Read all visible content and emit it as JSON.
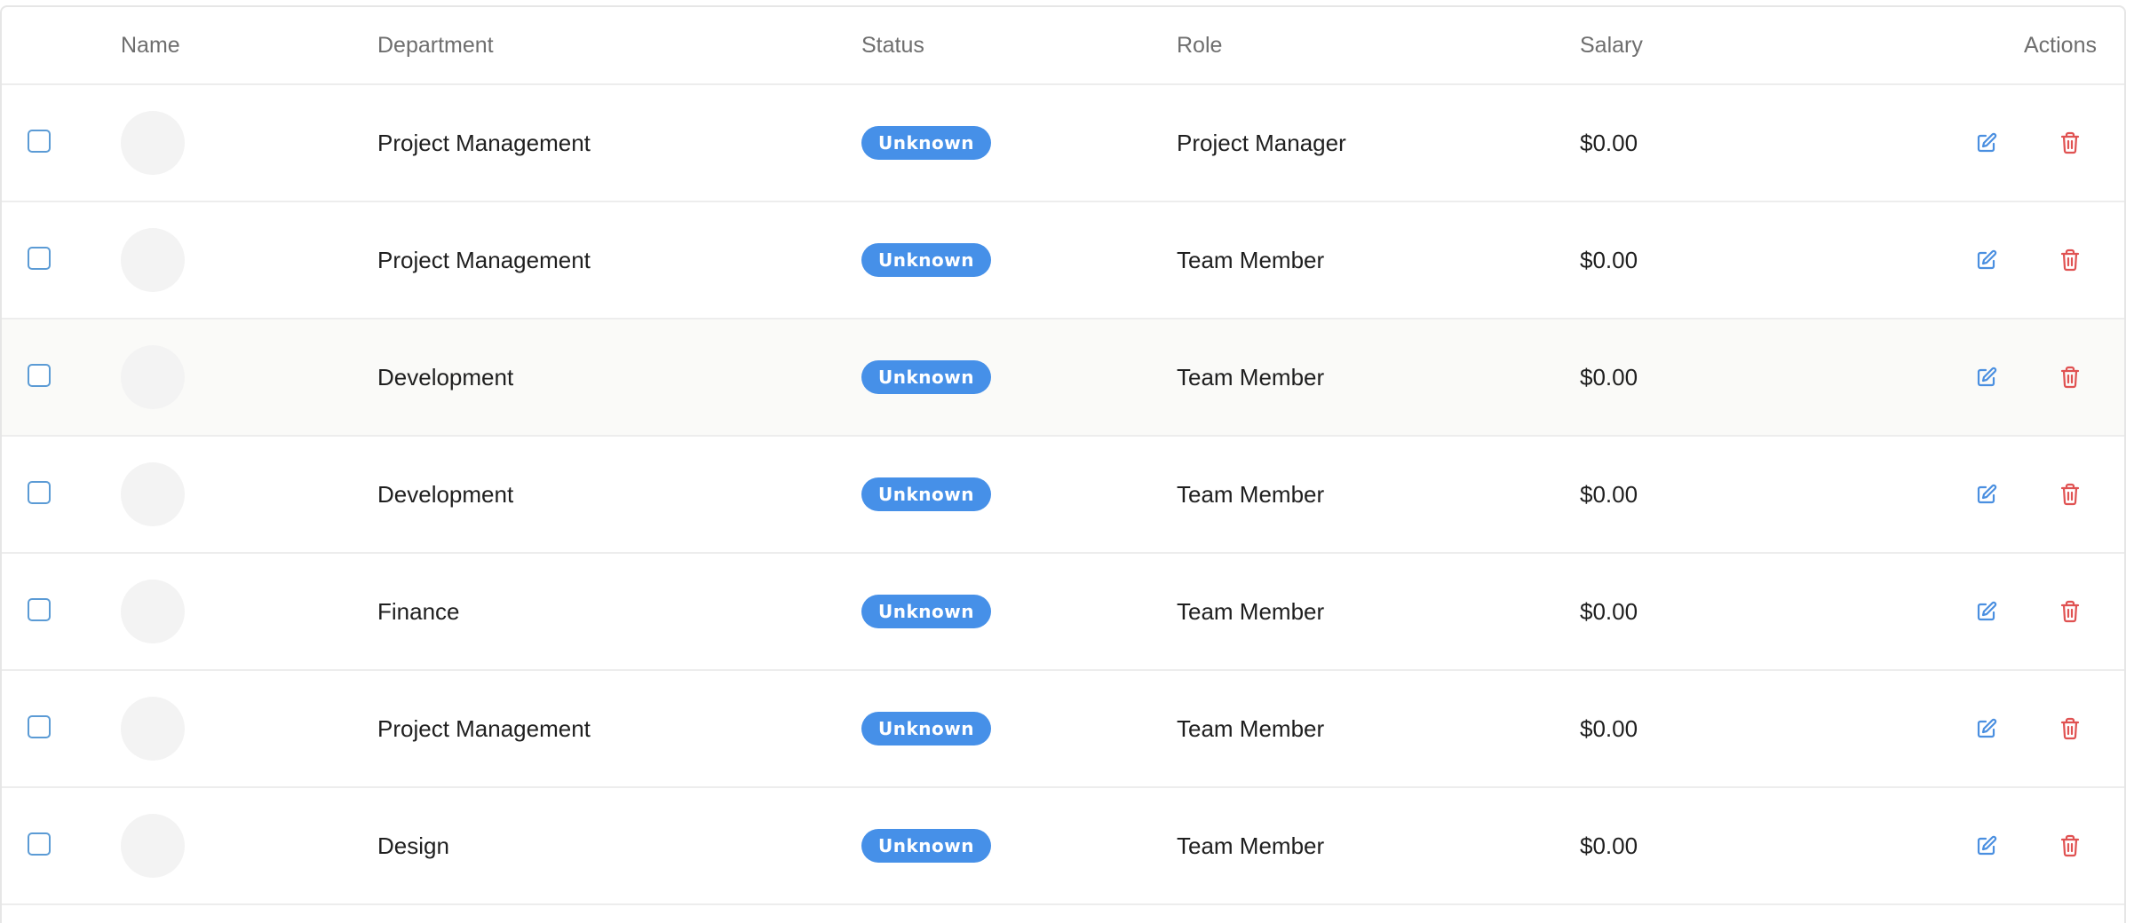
{
  "table": {
    "columns": {
      "name": "Name",
      "department": "Department",
      "status": "Status",
      "role": "Role",
      "salary": "Salary",
      "actions": "Actions"
    },
    "rows": [
      {
        "department": "Project Management",
        "status": "Unknown",
        "role": "Project Manager",
        "salary": "$0.00"
      },
      {
        "department": "Project Management",
        "status": "Unknown",
        "role": "Team Member",
        "salary": "$0.00"
      },
      {
        "department": "Development",
        "status": "Unknown",
        "role": "Team Member",
        "salary": "$0.00"
      },
      {
        "department": "Development",
        "status": "Unknown",
        "role": "Team Member",
        "salary": "$0.00"
      },
      {
        "department": "Finance",
        "status": "Unknown",
        "role": "Team Member",
        "salary": "$0.00"
      },
      {
        "department": "Project Management",
        "status": "Unknown",
        "role": "Team Member",
        "salary": "$0.00"
      },
      {
        "department": "Design",
        "status": "Unknown",
        "role": "Team Member",
        "salary": "$0.00"
      }
    ]
  },
  "icons": {
    "edit": "edit-icon",
    "delete": "trash-icon"
  },
  "colors": {
    "status_badge": "#4690e8",
    "edit_icon": "#4a8fe0",
    "delete_icon": "#e05252",
    "checkbox_border": "#5b9bd5",
    "hovered_row": "#fafaf8"
  }
}
